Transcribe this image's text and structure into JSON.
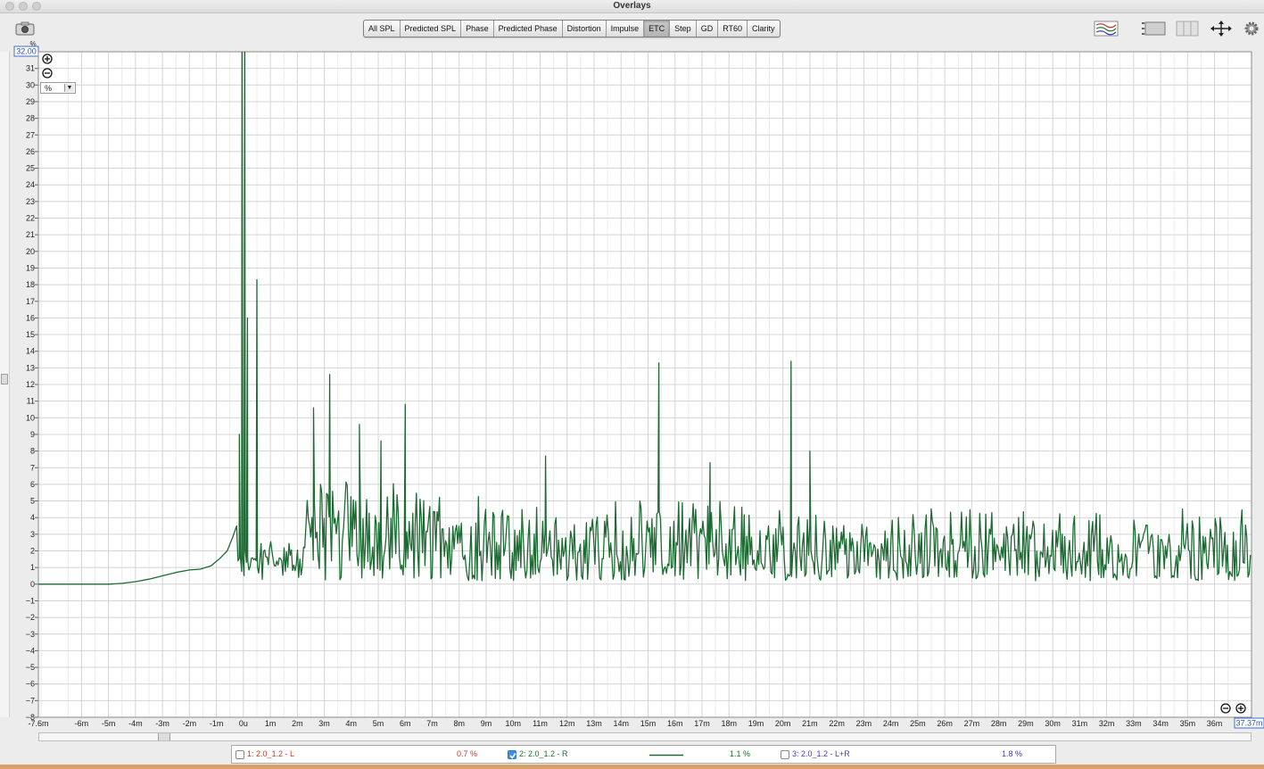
{
  "window": {
    "title": "Overlays"
  },
  "tabs": [
    {
      "label": "All SPL",
      "active": false
    },
    {
      "label": "Predicted SPL",
      "active": false
    },
    {
      "label": "Phase",
      "active": false
    },
    {
      "label": "Predicted Phase",
      "active": false
    },
    {
      "label": "Distortion",
      "active": false
    },
    {
      "label": "Impulse",
      "active": false
    },
    {
      "label": "ETC",
      "active": true
    },
    {
      "label": "Step",
      "active": false
    },
    {
      "label": "GD",
      "active": false
    },
    {
      "label": "RT60",
      "active": false
    },
    {
      "label": "Clarity",
      "active": false
    }
  ],
  "toolbar": {
    "icons": [
      "camera-icon",
      "trace-arrange-icon",
      "controls-icon",
      "columns-icon",
      "move-arrows-icon",
      "gear-icon"
    ]
  },
  "plot": {
    "y_unit": "%",
    "y_max_readout": "32.00",
    "x_max_readout": "37.37m",
    "unit_select_value": "%",
    "colors": {
      "grid": "#d4d4d4",
      "background": "#ffffff",
      "trace": "#1c6b32"
    }
  },
  "legend": [
    {
      "label": "1: 2.0_1.2 - L",
      "value": "0.7 %",
      "checked": false,
      "color": "#c0392b"
    },
    {
      "label": "2: 2.0_1.2 - R",
      "value": "1.1 %",
      "checked": true,
      "color": "#1c6b32"
    },
    {
      "label": "3: 2.0_1.2 - L+R",
      "value": "1.8 %",
      "checked": false,
      "color": "#3e3ec0"
    }
  ],
  "chart_data": {
    "type": "line",
    "title": "",
    "xlabel": "",
    "ylabel": "%",
    "xlim": [
      -7.6,
      37.37
    ],
    "ylim": [
      -8,
      32
    ],
    "grid": true,
    "legend": "bottom",
    "x_ticks": [
      -6,
      -5,
      -4,
      -3,
      -2,
      -1,
      0,
      1,
      2,
      3,
      4,
      5,
      6,
      7,
      8,
      9,
      10,
      11,
      12,
      13,
      14,
      15,
      16,
      17,
      18,
      19,
      20,
      21,
      22,
      23,
      24,
      25,
      26,
      27,
      28,
      29,
      30,
      31,
      32,
      33,
      34,
      35,
      36
    ],
    "x_tick_labels": [
      "-6m",
      "-5m",
      "-4m",
      "-3m",
      "-2m",
      "-1m",
      "0u",
      "1m",
      "2m",
      "3m",
      "4m",
      "5m",
      "6m",
      "7m",
      "8m",
      "9m",
      "10m",
      "11m",
      "12m",
      "13m",
      "14m",
      "15m",
      "16m",
      "17m",
      "18m",
      "19m",
      "20m",
      "21m",
      "22m",
      "23m",
      "24m",
      "25m",
      "26m",
      "27m",
      "28m",
      "29m",
      "30m",
      "31m",
      "32m",
      "33m",
      "34m",
      "35m",
      "36m"
    ],
    "x_start_label": "-7.6m",
    "y_ticks": [
      -8,
      -7,
      -6,
      -5,
      -4,
      -3,
      -2,
      -1,
      0,
      1,
      2,
      3,
      4,
      5,
      6,
      7,
      8,
      9,
      10,
      11,
      12,
      13,
      14,
      15,
      16,
      17,
      18,
      19,
      20,
      21,
      22,
      23,
      24,
      25,
      26,
      27,
      28,
      29,
      30,
      31
    ],
    "series": [
      {
        "name": "2: 2.0_1.2 - R",
        "color": "#1c6b32",
        "smooth": [
          [
            -7.6,
            0
          ],
          [
            -5,
            0
          ],
          [
            -4.5,
            0.05
          ],
          [
            -4,
            0.15
          ],
          [
            -3.5,
            0.3
          ],
          [
            -3,
            0.5
          ],
          [
            -2.5,
            0.7
          ],
          [
            -2,
            0.85
          ],
          [
            -1.6,
            0.9
          ],
          [
            -1.2,
            1.1
          ],
          [
            -0.9,
            1.5
          ],
          [
            -0.6,
            2
          ],
          [
            -0.4,
            2.8
          ],
          [
            -0.25,
            3.5
          ]
        ],
        "peaks": [
          [
            -0.15,
            9
          ],
          [
            -0.05,
            32
          ],
          [
            0.05,
            32
          ],
          [
            0.15,
            16
          ],
          [
            0.5,
            18.3
          ],
          [
            2.6,
            10.6
          ],
          [
            3.2,
            12.6
          ],
          [
            4.3,
            9.6
          ],
          [
            5.1,
            8.6
          ],
          [
            6,
            10.8
          ],
          [
            11.2,
            7.7
          ],
          [
            15.4,
            13.3
          ],
          [
            17.3,
            7.3
          ],
          [
            20.3,
            13.4
          ],
          [
            21,
            8
          ]
        ],
        "noise": {
          "seed": 20240611,
          "x_start": -0.2,
          "x_end": 37.37,
          "step": 0.045,
          "segments": [
            {
              "x0": -0.2,
              "x1": 2.2,
              "base": 1.3,
              "amp": 1.5
            },
            {
              "x0": 2.2,
              "x1": 7.6,
              "base": 2.7,
              "amp": 4.0
            },
            {
              "x0": 7.6,
              "x1": 14.5,
              "base": 2.2,
              "amp": 3.2
            },
            {
              "x0": 14.5,
              "x1": 18.6,
              "base": 2.2,
              "amp": 3.2
            },
            {
              "x0": 18.6,
              "x1": 22.5,
              "base": 1.9,
              "amp": 3.0
            },
            {
              "x0": 22.5,
              "x1": 37.37,
              "base": 1.9,
              "amp": 2.8
            }
          ]
        }
      }
    ]
  }
}
